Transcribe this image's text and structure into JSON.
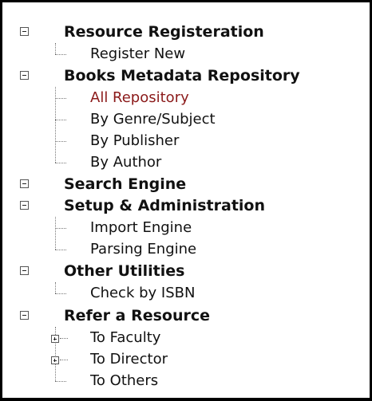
{
  "tree": {
    "sections": [
      {
        "label": "Resource Registeration",
        "children": [
          "Register New"
        ]
      },
      {
        "label": "Books Metadata Repository",
        "children": [
          "All Repository",
          "By Genre/Subject",
          "By Publisher",
          "By Author"
        ]
      },
      {
        "label": "Search Engine",
        "children": []
      },
      {
        "label": "Setup & Administration",
        "children": [
          "Import Engine",
          "Parsing Engine"
        ]
      },
      {
        "label": "Other Utilities",
        "children": [
          "Check by ISBN"
        ]
      },
      {
        "label": "Refer a Resource",
        "children": [
          "To Faculty",
          "To Director",
          "To Others"
        ]
      }
    ],
    "active_item": "All Repository",
    "active_color": "#8b1a1a"
  }
}
